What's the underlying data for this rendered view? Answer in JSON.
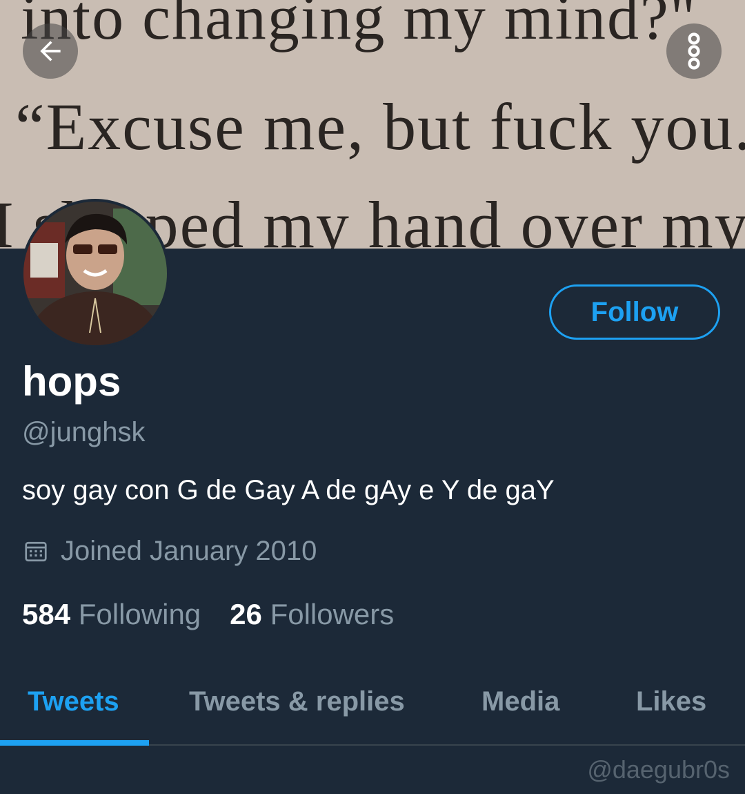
{
  "header": {
    "banner_lines": [
      "into changing my mind?\"",
      "“Excuse me, but fuck you.”",
      "I slapped my hand over my"
    ],
    "back_icon": "arrow-left-icon",
    "more_icon": "more-vertical-icon"
  },
  "profile": {
    "display_name": "hops",
    "handle": "@junghsk",
    "bio": "soy gay con G de Gay A de gAy e Y de gaY",
    "joined": "Joined January 2010",
    "following_count": "584",
    "following_label": "Following",
    "followers_count": "26",
    "followers_label": "Followers",
    "follow_label": "Follow"
  },
  "tabs": [
    {
      "label": "Tweets",
      "active": true
    },
    {
      "label": "Tweets & replies",
      "active": false
    },
    {
      "label": "Media",
      "active": false
    },
    {
      "label": "Likes",
      "active": false
    }
  ],
  "watermark": "@daegubr0s",
  "colors": {
    "background": "#1c2938",
    "accent": "#1da1f2",
    "muted": "#8899a6",
    "banner": "#c9bdb3"
  }
}
